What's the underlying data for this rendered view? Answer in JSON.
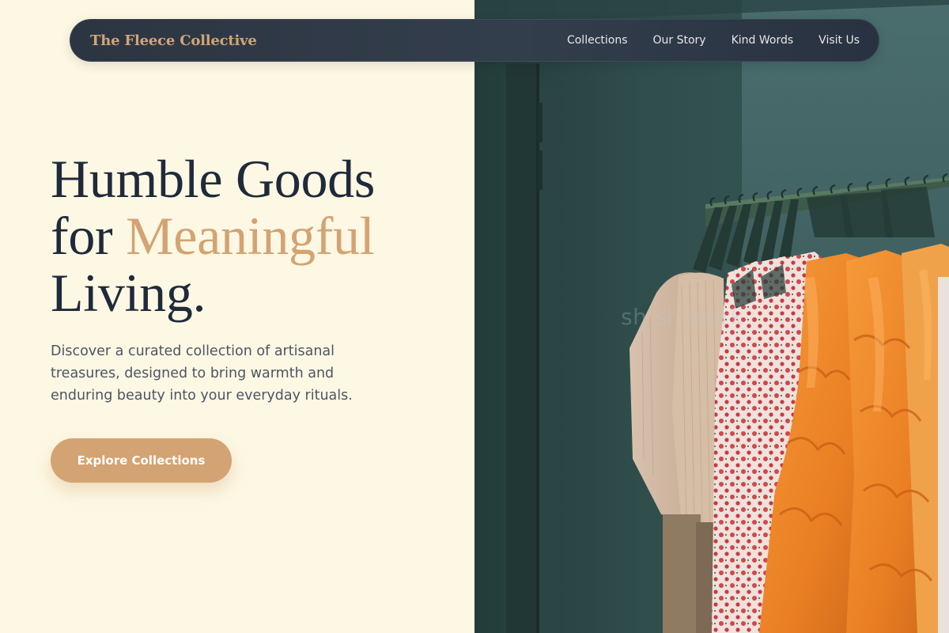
{
  "nav": {
    "brand": "The Fleece Collective",
    "links": [
      "Collections",
      "Our Story",
      "Kind Words",
      "Visit Us"
    ]
  },
  "hero": {
    "title_part1": "Humble Goods",
    "title_part2": "for ",
    "title_accent": "Meaningful",
    "title_part3": "Living.",
    "subtitle": "Discover a curated collection of artisanal treasures, designed to bring warmth and enduring beauty into your everyday rituals.",
    "cta_label": "Explore Collections"
  },
  "image": {
    "alt": "Clothing rack with cream knit, red floral and orange ruffled garments",
    "watermark": "sh  sh work"
  },
  "colors": {
    "background": "#fdf8e4",
    "navbar": "#2c3542",
    "accent": "#d4a373",
    "heading": "#1f2a3b",
    "body_text": "#4c5562"
  }
}
